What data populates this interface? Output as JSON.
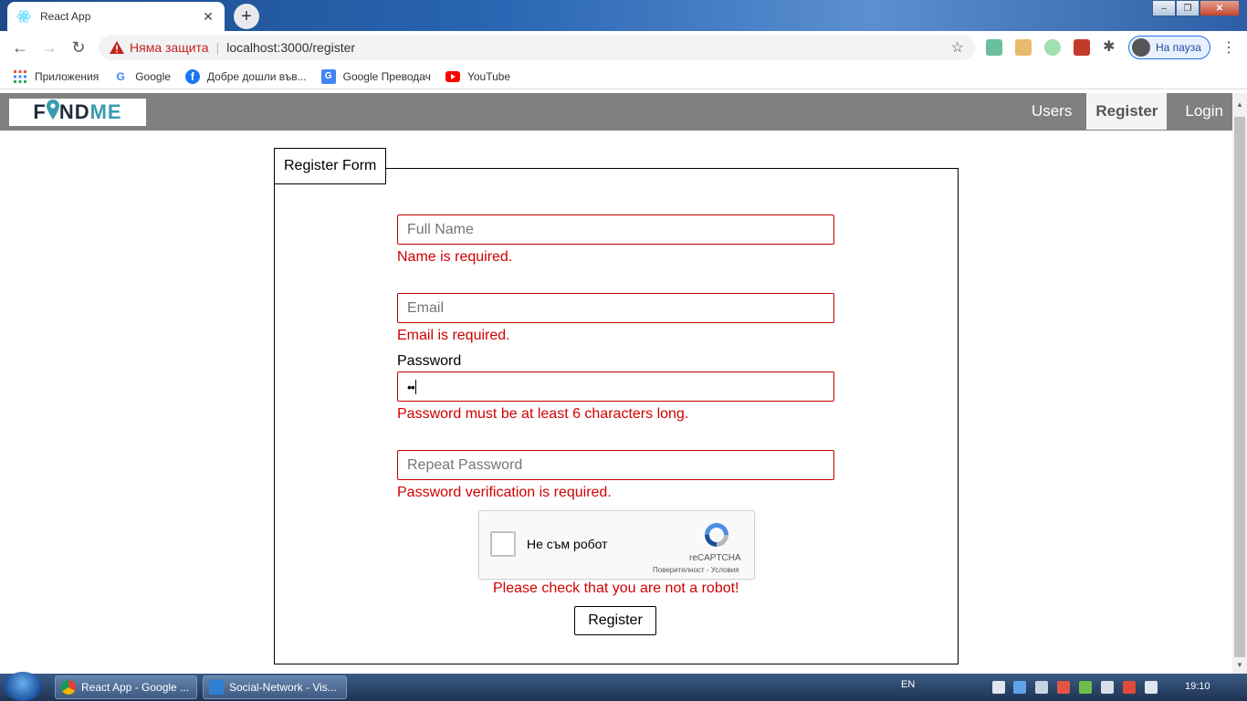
{
  "browser": {
    "tab_title": "React App",
    "tab_close": "✕",
    "new_tab": "+",
    "security_label": "Няма защита",
    "url": "localhost:3000/register",
    "profile_label": "На пауза",
    "bookmarks": [
      {
        "label": "Приложения",
        "icon": "apps-grid-icon"
      },
      {
        "label": "Google",
        "icon": "google-icon"
      },
      {
        "label": "Добре дошли във...",
        "icon": "facebook-icon"
      },
      {
        "label": "Google Преводач",
        "icon": "google-translate-icon"
      },
      {
        "label": "YouTube",
        "icon": "youtube-icon"
      }
    ]
  },
  "navbar": {
    "logo_part1": "F",
    "logo_part2": "ND",
    "logo_part3": "ME",
    "links": [
      "Users",
      "Register",
      "Login"
    ],
    "active_link": "Register"
  },
  "form": {
    "legend": "Register Form",
    "full_name_placeholder": "Full Name",
    "full_name_error": "Name is required.",
    "email_placeholder": "Email",
    "email_error": "Email is required.",
    "password_label": "Password",
    "password_value": "••",
    "password_error": "Password must be at least 6 characters long.",
    "repeat_placeholder": "Repeat Password",
    "repeat_error": "Password verification is required.",
    "recaptcha_label": "Не съм робот",
    "recaptcha_brand": "reCAPTCHA",
    "recaptcha_links": "Поверителност - Условия",
    "robot_error": "Please check that you are not a robot!",
    "submit_label": "Register"
  },
  "taskbar": {
    "tasks": [
      "React App - Google ...",
      "Social-Network - Vis..."
    ],
    "lang": "EN",
    "clock": "19:10"
  },
  "colors": {
    "error": "#d00000",
    "navbar_bg": "#808080",
    "logo_teal": "#3a9bb0"
  }
}
